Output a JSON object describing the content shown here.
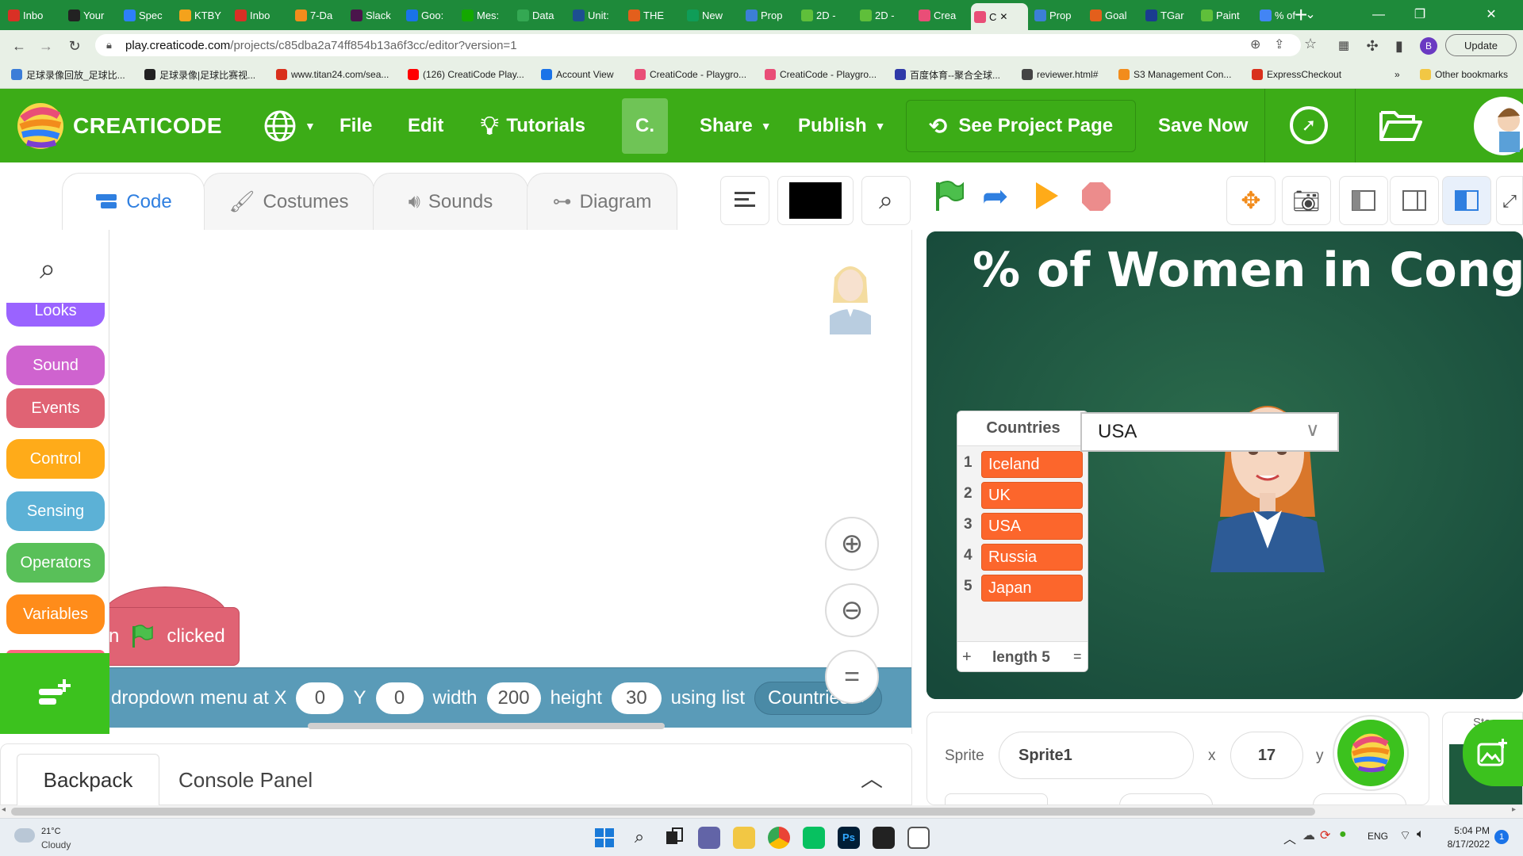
{
  "browser": {
    "tabs": [
      {
        "label": "Inbo",
        "color": "#d93025"
      },
      {
        "label": "Your",
        "color": "#222222"
      },
      {
        "label": "Spec",
        "color": "#2d7ff9"
      },
      {
        "label": "KTBY",
        "color": "#f4a21c"
      },
      {
        "label": "Inbo",
        "color": "#d93025"
      },
      {
        "label": "7-Da",
        "color": "#f28c1c"
      },
      {
        "label": "Slack",
        "color": "#4a154b"
      },
      {
        "label": "Goo:",
        "color": "#1a73e8"
      },
      {
        "label": "Mes:",
        "color": "#14a800"
      },
      {
        "label": "Data",
        "color": "#34a853"
      },
      {
        "label": "Unit:",
        "color": "#1d4f91"
      },
      {
        "label": "THE",
        "color": "#e35f1c"
      },
      {
        "label": "New",
        "color": "#0f9d58"
      },
      {
        "label": "Prop",
        "color": "#3c7fd6"
      },
      {
        "label": "2D -",
        "color": "#5fbf3a"
      },
      {
        "label": "2D -",
        "color": "#5fbf3a"
      },
      {
        "label": "Crea",
        "color": "#e94e77"
      },
      {
        "label": "C",
        "color": "#e94e77"
      },
      {
        "label": "Prop",
        "color": "#3c7fd6"
      },
      {
        "label": "Goal",
        "color": "#e35f1c"
      },
      {
        "label": "TGar",
        "color": "#1a3c8f"
      },
      {
        "label": "Paint",
        "color": "#5fbf3a"
      },
      {
        "label": "% of",
        "color": "#4285f4"
      }
    ],
    "url_host": "play.creaticode.com",
    "url_path": "/projects/c85dba2a74ff854b13a6f3cc/editor?version=1",
    "update_label": "Update",
    "profile_letter": "B",
    "bookmarks": [
      {
        "label": "足球录像回放_足球比...",
        "color": "#3b7dd8"
      },
      {
        "label": "足球录像|足球比赛视...",
        "color": "#222222"
      },
      {
        "label": "www.titan24.com/sea...",
        "color": "#d9301c"
      },
      {
        "label": "(126) CreatiCode Play...",
        "color": "#ff0000"
      },
      {
        "label": "Account View",
        "color": "#1a73e8"
      },
      {
        "label": "CreatiCode - Playgro...",
        "color": "#e94e77"
      },
      {
        "label": "CreatiCode - Playgro...",
        "color": "#e94e77"
      },
      {
        "label": "百度体育--聚合全球...",
        "color": "#2f3aa8"
      },
      {
        "label": "reviewer.html#",
        "color": "#444444"
      },
      {
        "label": "S3 Management Con...",
        "color": "#f28c1c"
      },
      {
        "label": "ExpressCheckout",
        "color": "#d9301c"
      }
    ],
    "bookmarks_more": "»",
    "other_bookmarks": "Other bookmarks"
  },
  "app": {
    "logo_text": "CREATICODE",
    "menu": {
      "file": "File",
      "edit": "Edit",
      "tutorials": "Tutorials",
      "c_button": "C.",
      "share": "Share",
      "publish": "Publish",
      "see_project": "See Project Page",
      "save_now": "Save Now"
    },
    "editor_tabs": {
      "code": "Code",
      "costumes": "Costumes",
      "sounds": "Sounds",
      "diagram": "Diagram"
    },
    "categories": [
      {
        "label": "Looks",
        "color": "#9a63ff"
      },
      {
        "label": "Sound",
        "color": "#cf63cf"
      },
      {
        "label": "Events",
        "color": "#e06374"
      },
      {
        "label": "Control",
        "color": "#ffab19"
      },
      {
        "label": "Sensing",
        "color": "#5cb1d6"
      },
      {
        "label": "Operators",
        "color": "#59c059"
      },
      {
        "label": "Variables",
        "color": "#ff8c1a"
      }
    ],
    "blocks": {
      "hat_text": "clicked",
      "hat_prefix": "n",
      "widget_text": "dropdown menu at X",
      "x_value": "0",
      "y_label": "Y",
      "y_value": "0",
      "width_label": "width",
      "width_value": "200",
      "height_label": "height",
      "height_value": "30",
      "using_label": "using list",
      "list_value": "Countries"
    },
    "bottom_panel": {
      "backpack": "Backpack",
      "console": "Console Panel"
    },
    "stage": {
      "title": "% of Women in Congress",
      "list_title": "Countries",
      "list_items": [
        "Iceland",
        "UK",
        "USA",
        "Russia",
        "Japan"
      ],
      "list_add": "+",
      "list_length": "length 5",
      "list_resize": "=",
      "dropdown_value": "USA"
    },
    "sprite_info": {
      "sprite_label": "Sprite",
      "sprite_name": "Sprite1",
      "x_label": "x",
      "x_value": "17",
      "y_label": "y",
      "stage_partial": "Stage"
    },
    "colors": {
      "header_green": "#3cac17",
      "list_item_orange": "#fc662c",
      "stage_green": "#1e5a3e",
      "block_blue": "#5a9bb8"
    }
  },
  "taskbar": {
    "temperature": "21°C",
    "weather": "Cloudy",
    "language": "ENG",
    "time": "5:04 PM",
    "date": "8/17/2022",
    "notif_count": "1"
  }
}
